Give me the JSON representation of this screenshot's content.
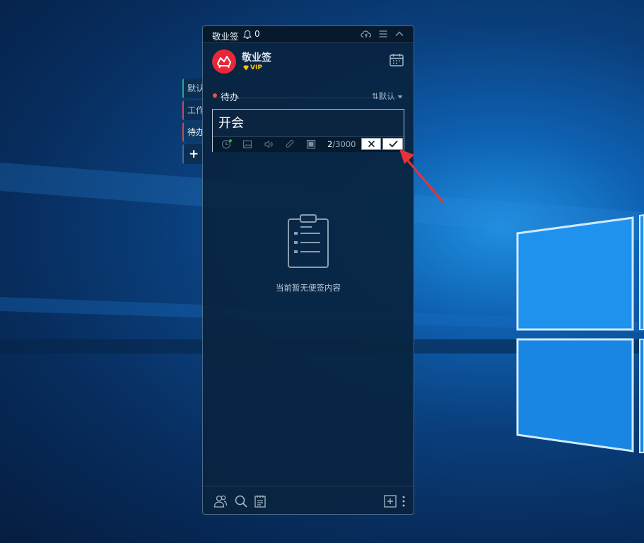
{
  "desktop": {
    "wallpaper": "windows-10-blue"
  },
  "side_tabs": [
    {
      "label": "默认",
      "accent": "#2aa58a"
    },
    {
      "label": "工作",
      "accent": "#c9485a"
    },
    {
      "label": "待办",
      "accent": "#d9434e",
      "active": true
    },
    {
      "label": "+"
    }
  ],
  "titlebar": {
    "title": "敬业签",
    "notification_count": "0",
    "icons": [
      "cloud-sync-icon",
      "menu-icon",
      "collapse-icon"
    ]
  },
  "header": {
    "username": "敬业签",
    "badge": "VIP",
    "badge_color": "#f5c518",
    "avatar_color": "#e8283a"
  },
  "section": {
    "name": "待办",
    "dot_color": "#f0533f",
    "sort_icon": "⇅",
    "sort_label": "默认"
  },
  "editor": {
    "text": "开会",
    "count_current": "2",
    "count_max": "/3000",
    "toolbar_icons": [
      "reminder-clock-icon",
      "image-icon",
      "audio-icon",
      "attachment-icon",
      "color-block-icon"
    ]
  },
  "empty_state": {
    "text": "当前暂无便签内容"
  },
  "footer": {
    "icons": [
      "contacts-icon",
      "search-icon",
      "notes-icon",
      "add-icon",
      "more-icon"
    ]
  },
  "annotation": {
    "color": "#e8323a"
  }
}
